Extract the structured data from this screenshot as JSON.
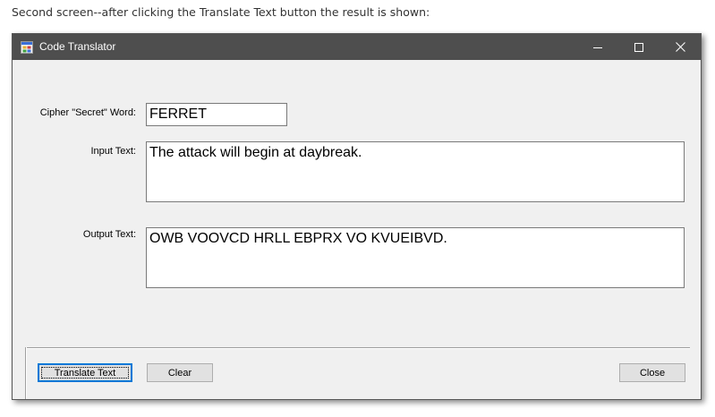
{
  "caption": "Second screen--after clicking the Translate Text button the result is shown:",
  "window": {
    "title": "Code Translator",
    "app_icon": "app-form-icon",
    "controls": [
      "minimize-icon",
      "maximize-icon",
      "close-icon"
    ]
  },
  "form": {
    "cipher_label": "Cipher \"Secret\" Word:",
    "cipher_value": "FERRET",
    "input_label": "Input Text:",
    "input_value": "The attack will begin at daybreak.",
    "output_label": "Output Text:",
    "output_value": "OWB VOOVCD HRLL EBPRX VO KVUEIBVD."
  },
  "buttons": {
    "translate_label": "Translate Text",
    "clear_label": "Clear",
    "close_label": "Close"
  },
  "colors": {
    "titlebar": "#4e4e4e",
    "window_bg": "#f0f0f0",
    "default_button_accent": "#0078d7"
  }
}
